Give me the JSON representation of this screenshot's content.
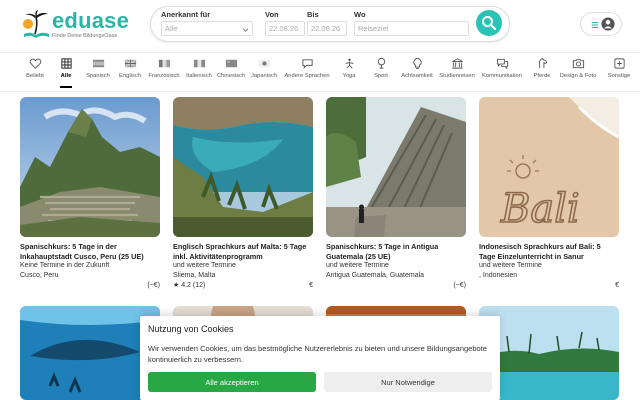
{
  "brand": {
    "name": "eduase",
    "tagline": "Finde Deine BildungsOase",
    "color": "#2bb5a6"
  },
  "search": {
    "accredited_label": "Anerkannt für",
    "accredited_value": "Alle",
    "from_label": "Von",
    "from_value": "22.08.26",
    "to_label": "Bis",
    "to_value": "22.08.26",
    "where_label": "Wo",
    "where_placeholder": "Reiseziel",
    "button_color": "#2bc3b5"
  },
  "categories": [
    {
      "label": "Beliebt",
      "icon": "heart-icon"
    },
    {
      "label": "Alle",
      "icon": "grid-icon",
      "active": true
    },
    {
      "label": "Spanisch",
      "icon": "flag-spain-icon"
    },
    {
      "label": "Englisch",
      "icon": "flag-uk-icon"
    },
    {
      "label": "Französisch",
      "icon": "flag-france-icon"
    },
    {
      "label": "Italienisch",
      "icon": "flag-italy-icon"
    },
    {
      "label": "Chinesisch",
      "icon": "flag-china-icon"
    },
    {
      "label": "Japanisch",
      "icon": "flag-japan-icon"
    },
    {
      "label": "Andere Sprachen",
      "icon": "speech-bubble-icon"
    },
    {
      "label": "Yoga",
      "icon": "yoga-icon"
    },
    {
      "label": "Sport",
      "icon": "sport-icon"
    },
    {
      "label": "Achtsamkeit",
      "icon": "lightbulb-icon"
    },
    {
      "label": "Studienreisen",
      "icon": "building-icon"
    },
    {
      "label": "Kommunikation",
      "icon": "chat-icon"
    },
    {
      "label": "Pferde",
      "icon": "horse-icon"
    },
    {
      "label": "Design & Foto",
      "icon": "camera-icon"
    },
    {
      "label": "Sonstige",
      "icon": "more-icon"
    }
  ],
  "cards": [
    {
      "title": "Spanischkurs: 5 Tage in der Inkahauptstadt Cusco, Peru (25 UE)",
      "line1": "Keine Termine in der Zukunft",
      "line2": "Cusco, Peru",
      "rating": "",
      "price": "(~€)"
    },
    {
      "title": "Englisch Sprachkurs auf Malta: 5 Tage inkl. Aktivitätenprogramm",
      "line1": " und weitere Termine",
      "line2": "Sliema, Malta",
      "rating": "★ 4.2 (12)",
      "price": "€"
    },
    {
      "title": "Spanischkurs: 5 Tage in Antigua Guatemala (25 UE)",
      "line1": " und weitere Termine",
      "line2": "Antigua Guatemala, Guatemala",
      "rating": "",
      "price": "(~€)"
    },
    {
      "title": "Indonesisch Sprachkurs auf Bali: 5 Tage Einzelunterricht in Sanur",
      "line1": " und weitere Termine",
      "line2": ", Indonesien",
      "rating": "",
      "price": "€"
    }
  ],
  "sand_text": "Bali",
  "cookie": {
    "title": "Nutzung von Cookies",
    "text": "Wir verwenden Cookies, um das bestmögliche Nutzererlebnis zu bieten und unsere Bildungsangebote kontinuierlich zu verbessern.",
    "accept_label": "Alle akzeptieren",
    "necessary_label": "Nur Notwendige",
    "accept_color": "#28a745"
  }
}
